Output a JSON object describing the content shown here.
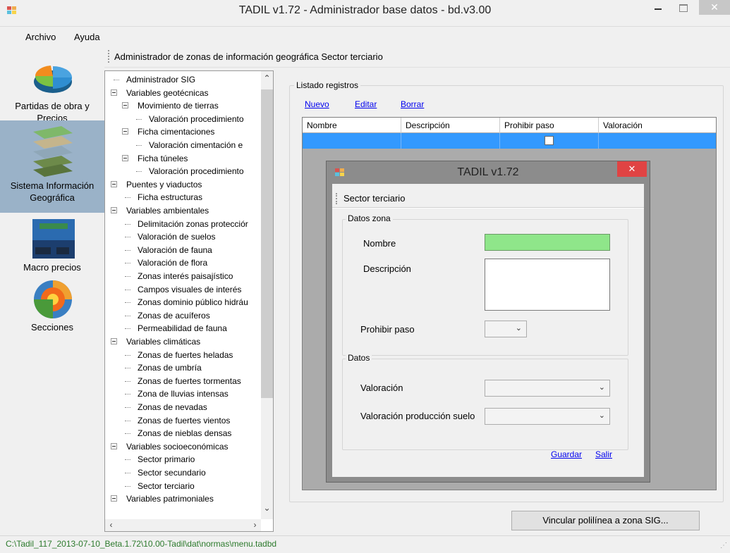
{
  "window": {
    "title": "TADIL v1.72 - Administrador base datos - bd.v3.00",
    "close_glyph": "✕"
  },
  "menu": [
    "Archivo",
    "Ayuda"
  ],
  "sidebar": {
    "items": [
      {
        "label": "Partidas de obra y Precios",
        "icon": "pie-chart-icon",
        "selected": false
      },
      {
        "label": "Sistema Información Geográfica",
        "icon": "gis-layers-icon",
        "selected": true
      },
      {
        "label": "Macro precios",
        "icon": "highway-sign-icon",
        "selected": false
      },
      {
        "label": "Secciones",
        "icon": "earth-section-icon",
        "selected": false
      }
    ]
  },
  "toolstrip": {
    "label": "Administrador de zonas de información geográfica  Sector terciario"
  },
  "tree": {
    "nodes": [
      {
        "label": "Administrador SIG",
        "level": 0,
        "expander": false
      },
      {
        "label": "Variables geotécnicas",
        "level": 0,
        "expander": true
      },
      {
        "label": "Movimiento de tierras",
        "level": 1,
        "expander": true
      },
      {
        "label": "Valoración procedimiento",
        "level": 2,
        "expander": false
      },
      {
        "label": "Ficha cimentaciones",
        "level": 1,
        "expander": true
      },
      {
        "label": "Valoración cimentación e",
        "level": 2,
        "expander": false
      },
      {
        "label": "Ficha túneles",
        "level": 1,
        "expander": true
      },
      {
        "label": "Valoración procedimiento",
        "level": 2,
        "expander": false
      },
      {
        "label": "Puentes y viaductos",
        "level": 0,
        "expander": true
      },
      {
        "label": "Ficha estructuras",
        "level": 1,
        "expander": false
      },
      {
        "label": "Variables ambientales",
        "level": 0,
        "expander": true
      },
      {
        "label": "Delimitación zonas protecciór",
        "level": 1,
        "expander": false
      },
      {
        "label": "Valoración de suelos",
        "level": 1,
        "expander": false
      },
      {
        "label": "Valoración de fauna",
        "level": 1,
        "expander": false
      },
      {
        "label": "Valoración de flora",
        "level": 1,
        "expander": false
      },
      {
        "label": "Zonas interés paisajístico",
        "level": 1,
        "expander": false
      },
      {
        "label": "Campos visuales de interés",
        "level": 1,
        "expander": false
      },
      {
        "label": "Zonas dominio público hidráu",
        "level": 1,
        "expander": false
      },
      {
        "label": "Zonas de acuíferos",
        "level": 1,
        "expander": false
      },
      {
        "label": "Permeabilidad de fauna",
        "level": 1,
        "expander": false
      },
      {
        "label": "Variables climáticas",
        "level": 0,
        "expander": true
      },
      {
        "label": "Zonas de fuertes heladas",
        "level": 1,
        "expander": false
      },
      {
        "label": "Zonas de umbría",
        "level": 1,
        "expander": false
      },
      {
        "label": "Zonas de fuertes tormentas",
        "level": 1,
        "expander": false
      },
      {
        "label": "Zona de lluvias intensas",
        "level": 1,
        "expander": false
      },
      {
        "label": "Zonas de nevadas",
        "level": 1,
        "expander": false
      },
      {
        "label": "Zonas de fuertes vientos",
        "level": 1,
        "expander": false
      },
      {
        "label": "Zonas de nieblas densas",
        "level": 1,
        "expander": false
      },
      {
        "label": "Variables socioeconómicas",
        "level": 0,
        "expander": true
      },
      {
        "label": "Sector primario",
        "level": 1,
        "expander": false
      },
      {
        "label": "Sector secundario",
        "level": 1,
        "expander": false
      },
      {
        "label": "Sector terciario",
        "level": 1,
        "expander": false
      },
      {
        "label": "Variables patrimoniales",
        "level": 0,
        "expander": true
      }
    ]
  },
  "listado": {
    "title": "Listado registros",
    "links": {
      "nuevo": "Nuevo",
      "editar": "Editar",
      "borrar": "Borrar"
    },
    "columns": [
      "Nombre",
      "Descripción",
      "Prohibir paso",
      "Valoración"
    ],
    "selected_row_color": "#3399ff",
    "prohibir_paso_checked": false
  },
  "dialog": {
    "title": "TADIL v1.72",
    "close_glyph": "✕",
    "strip_label": "Sector terciario",
    "group_zona": "Datos zona",
    "nombre_label": "Nombre",
    "nombre_value": "",
    "descripcion_label": "Descripción",
    "descripcion_value": "",
    "prohibir_label": "Prohibir paso",
    "prohibir_value": "",
    "group_datos": "Datos",
    "valoracion_label": "Valoración",
    "valoracion_value": "",
    "valoracion_suelo_label": "Valoración producción suelo",
    "valoracion_suelo_value": "",
    "guardar": "Guardar",
    "salir": "Salir",
    "nombre_field_color": "#8fe68a"
  },
  "vincular_button": "Vincular polilínea a zona SIG...",
  "status": {
    "path": "C:\\Tadil_117_2013-07-10_Beta.1.72\\10.00-Tadil\\dat\\normas\\menu.tadbd"
  }
}
